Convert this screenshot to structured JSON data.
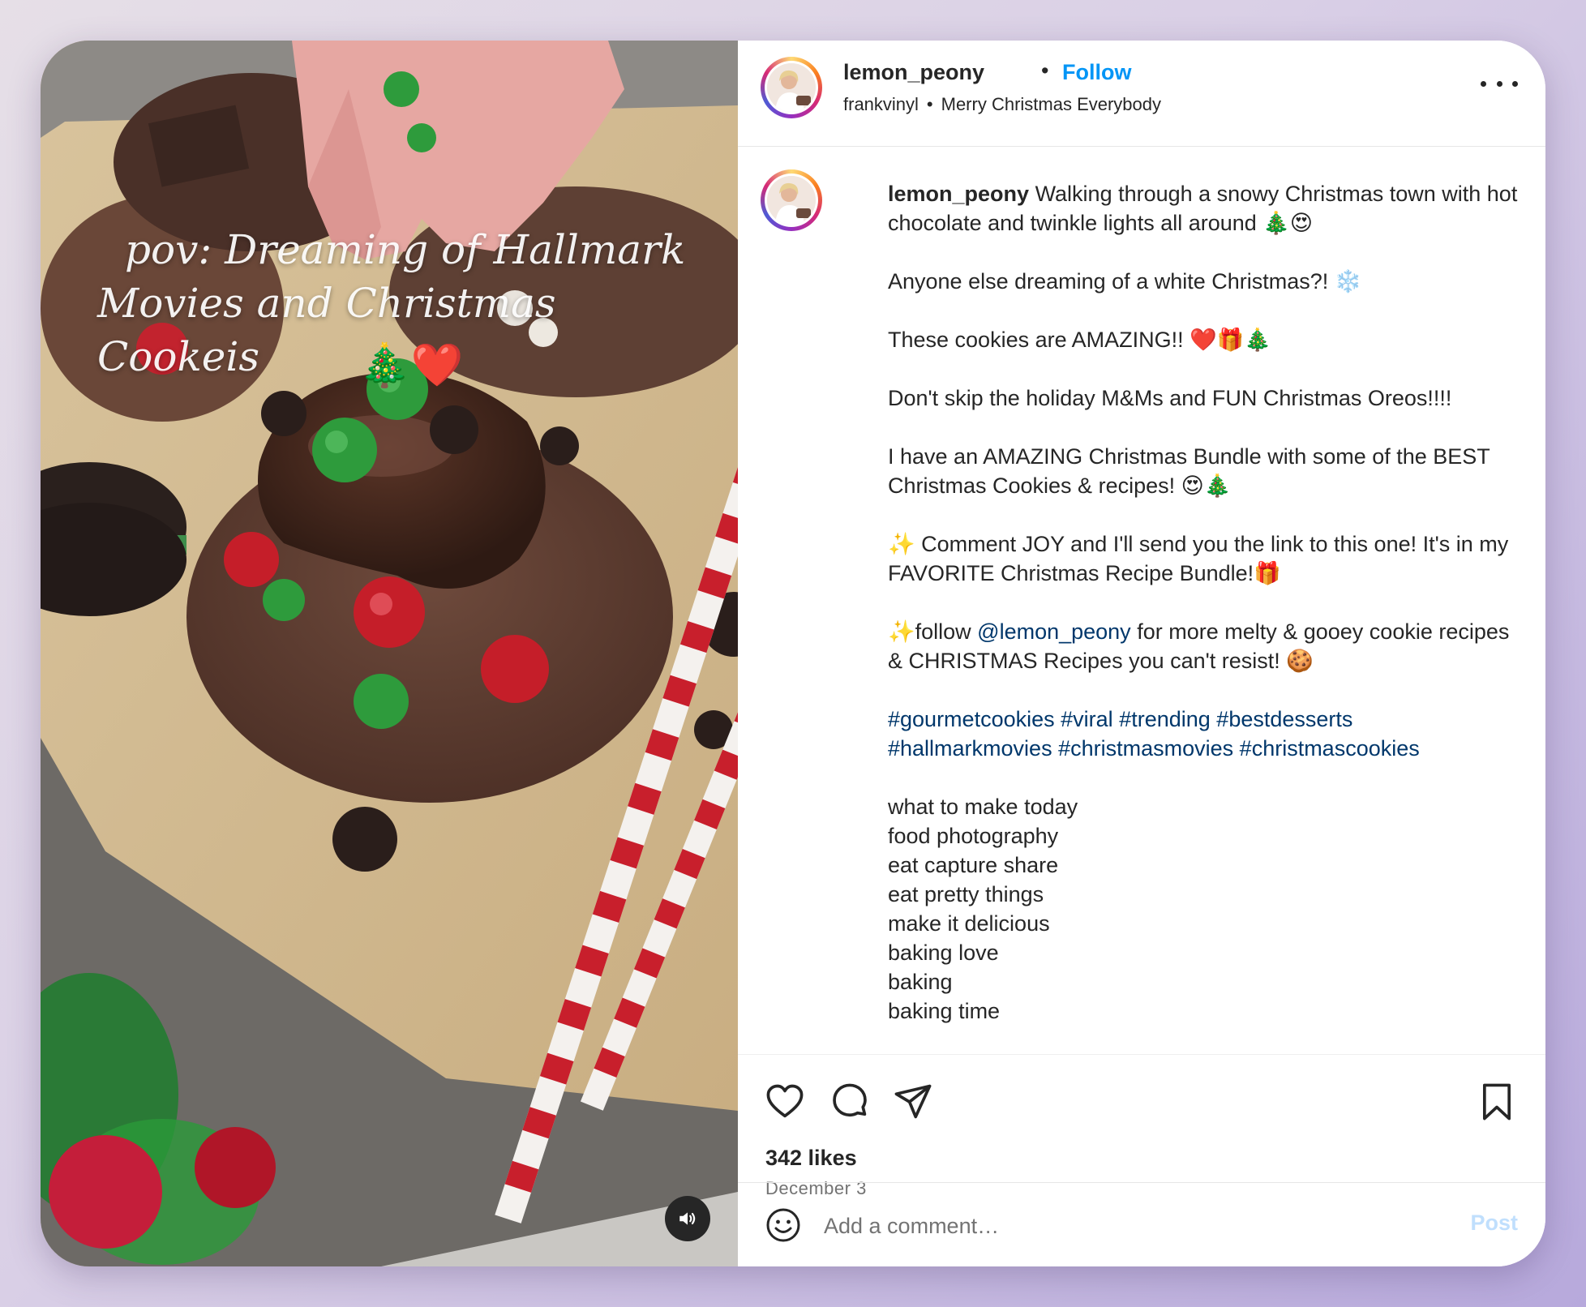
{
  "media": {
    "overlay_line1": "pov: Dreaming of Hallmark",
    "overlay_line2": "Movies and Christmas Cookeis",
    "overlay_emoji": "🎄❤️"
  },
  "header": {
    "username": "lemon_peony",
    "separator": "•",
    "follow_label": "Follow",
    "audio_artist": "frankvinyl",
    "audio_title": "Merry Christmas Everybody"
  },
  "caption": {
    "username": "lemon_peony",
    "p1": "Walking through a snowy Christmas town with hot chocolate and twinkle lights all around 🎄😍",
    "p2": "Anyone else dreaming of a white Christmas?! ❄️",
    "p3": "These cookies are AMAZING!! ❤️🎁🎄",
    "p4": "Don't skip the holiday M&Ms and FUN Christmas Oreos!!!!",
    "p5": "I have an AMAZING Christmas Bundle with some of the BEST Christmas Cookies & recipes! 😍🎄",
    "p6": "✨ Comment JOY and I'll send you the link to this one! It's in my FAVORITE Christmas Recipe Bundle!🎁",
    "p7_before": "✨follow ",
    "p7_mention": "@lemon_peony",
    "p7_after": " for more melty & gooey cookie recipes & CHRISTMAS Recipes you can't resist! 🍪",
    "hashtags": [
      "#gourmetcookies",
      "#viral",
      "#trending",
      "#bestdesserts",
      "#hallmarkmovies",
      "#christmasmovies",
      "#christmascookies"
    ],
    "tags": [
      "what to make today",
      "food photography",
      "eat capture share",
      "eat pretty things",
      "make it delicious",
      "baking love",
      "baking",
      "baking time"
    ]
  },
  "actions": {
    "likes": "342 likes",
    "date": "December 3"
  },
  "comment": {
    "placeholder": "Add a comment…",
    "post_label": "Post"
  },
  "colors": {
    "accent_blue": "#0095f6",
    "link_blue": "#00376b",
    "text": "#262626",
    "muted": "#737373",
    "post_disabled": "#c0dffd"
  },
  "icons": {
    "like": "heart-icon",
    "comment": "comment-icon",
    "share": "send-icon",
    "save": "bookmark-icon",
    "more": "more-icon",
    "emoji": "smiley-icon",
    "audio": "speaker-icon"
  }
}
